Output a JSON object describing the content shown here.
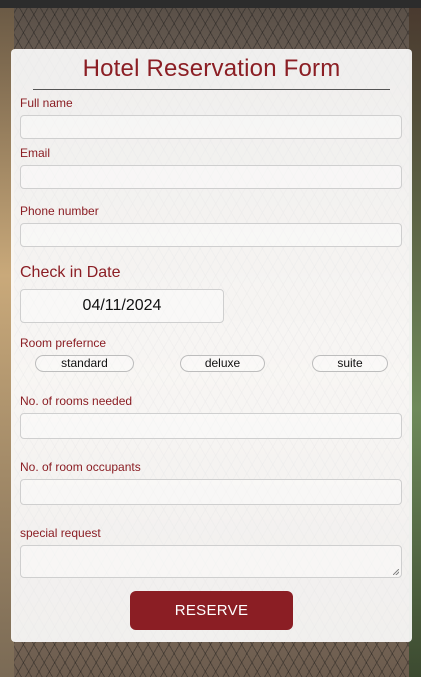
{
  "form": {
    "title": "Hotel Reservation Form",
    "full_name_label": "Full name",
    "full_name_value": "",
    "email_label": "Email",
    "email_value": "",
    "phone_label": "Phone number",
    "phone_value": "",
    "checkin_label": "Check in Date",
    "checkin_value": "04/11/2024",
    "room_pref_label": "Room prefernce",
    "room_options": [
      "standard",
      "deluxe",
      "suite"
    ],
    "rooms_needed_label": "No. of rooms needed",
    "rooms_needed_value": "",
    "occupants_label": "No. of room occupants",
    "occupants_value": "",
    "special_label": "special request",
    "special_value": "",
    "submit_label": "RESERVE"
  },
  "colors": {
    "accent": "#8b1e24",
    "button_text": "#ffffff",
    "card_bg": "#ffffff"
  }
}
